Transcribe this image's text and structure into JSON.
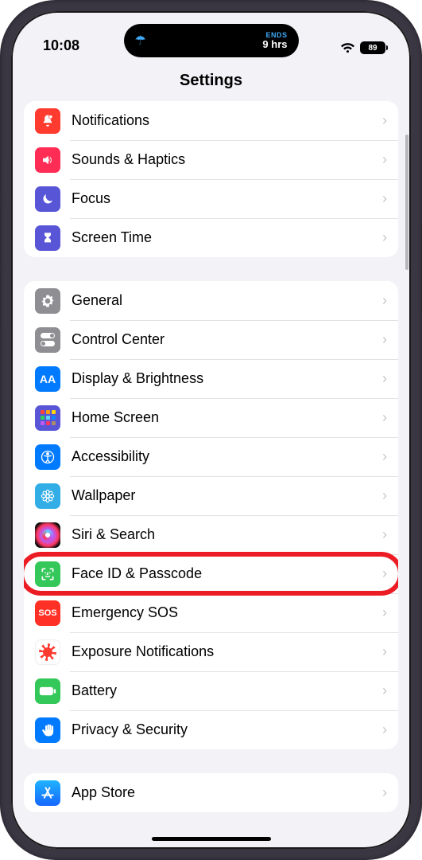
{
  "status": {
    "time": "10:08",
    "island_ends_label": "ENDS",
    "island_ends_value": "9 hrs",
    "battery": "89"
  },
  "header": {
    "title": "Settings"
  },
  "group1": [
    {
      "label": "Notifications",
      "icon": "bell-badge-icon",
      "color": "bg-red"
    },
    {
      "label": "Sounds & Haptics",
      "icon": "speaker-icon",
      "color": "bg-pink"
    },
    {
      "label": "Focus",
      "icon": "moon-icon",
      "color": "bg-indigo"
    },
    {
      "label": "Screen Time",
      "icon": "hourglass-icon",
      "color": "bg-indigo"
    }
  ],
  "group2": [
    {
      "label": "General",
      "icon": "gear-icon",
      "color": "bg-gray"
    },
    {
      "label": "Control Center",
      "icon": "toggles-icon",
      "color": "bg-gray"
    },
    {
      "label": "Display & Brightness",
      "icon": "text-size-icon",
      "color": "bg-blue"
    },
    {
      "label": "Home Screen",
      "icon": "app-grid-icon",
      "color": "bg-indigo"
    },
    {
      "label": "Accessibility",
      "icon": "accessibility-icon",
      "color": "bg-blue"
    },
    {
      "label": "Wallpaper",
      "icon": "flower-icon",
      "color": "bg-cyan"
    },
    {
      "label": "Siri & Search",
      "icon": "siri-icon",
      "color": "bg-black"
    },
    {
      "label": "Face ID & Passcode",
      "icon": "faceid-icon",
      "color": "bg-green",
      "highlight": true
    },
    {
      "label": "Emergency SOS",
      "icon": "sos-icon",
      "color": "bg-sosred"
    },
    {
      "label": "Exposure Notifications",
      "icon": "covid-icon",
      "color": "bg-white"
    },
    {
      "label": "Battery",
      "icon": "battery-icon",
      "color": "bg-green"
    },
    {
      "label": "Privacy & Security",
      "icon": "hand-icon",
      "color": "bg-blue"
    }
  ],
  "group3": [
    {
      "label": "App Store",
      "icon": "appstore-icon",
      "color": "bg-blue"
    }
  ]
}
